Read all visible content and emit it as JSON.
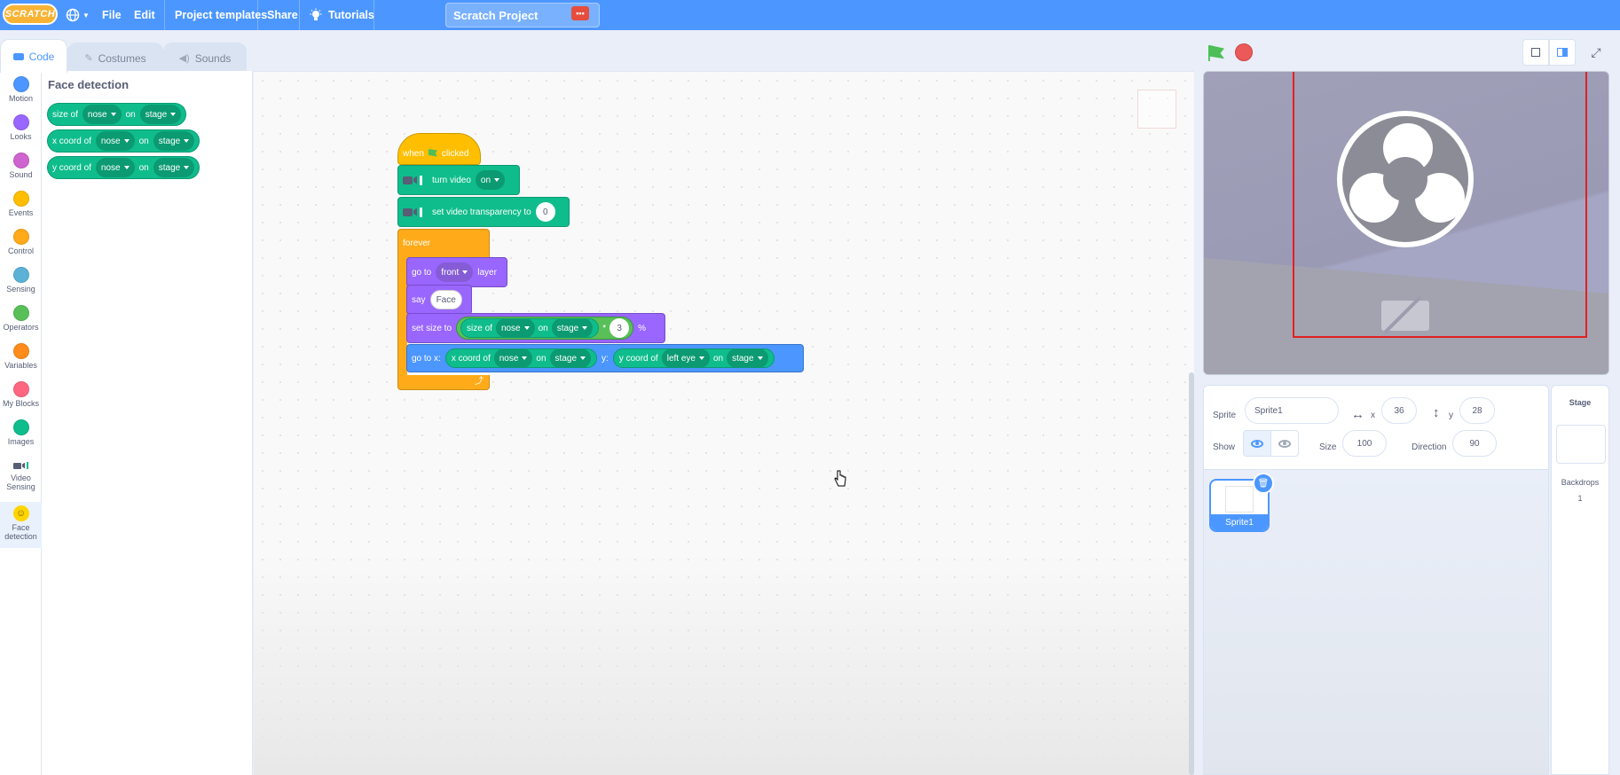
{
  "menubar": {
    "logo": "SCRATCH",
    "file": "File",
    "edit": "Edit",
    "project_templates": "Project templates",
    "share": "Share",
    "tutorials": "Tutorials",
    "project_title": "Scratch Project"
  },
  "tabs": {
    "code": "Code",
    "costumes": "Costumes",
    "sounds": "Sounds"
  },
  "categories": [
    {
      "label": "Motion",
      "color": "#4c97ff"
    },
    {
      "label": "Looks",
      "color": "#9966ff"
    },
    {
      "label": "Sound",
      "color": "#cf63cf"
    },
    {
      "label": "Events",
      "color": "#ffbf00"
    },
    {
      "label": "Control",
      "color": "#ffab19"
    },
    {
      "label": "Sensing",
      "color": "#5cb1d6"
    },
    {
      "label": "Operators",
      "color": "#59c059"
    },
    {
      "label": "Variables",
      "color": "#ff8c1a"
    },
    {
      "label": "My Blocks",
      "color": "#ff6680"
    },
    {
      "label": "Images",
      "color": "#0fbd8c"
    },
    {
      "label": "Video Sensing",
      "color": "#0fbd8c"
    },
    {
      "label": "Face detection",
      "color": "#ffd500"
    }
  ],
  "palette": {
    "title": "Face detection",
    "blocks": [
      {
        "prefix": "size of",
        "part": "nose",
        "on": "on",
        "target": "stage"
      },
      {
        "prefix": "x coord of",
        "part": "nose",
        "on": "on",
        "target": "stage"
      },
      {
        "prefix": "y coord of",
        "part": "nose",
        "on": "on",
        "target": "stage"
      }
    ]
  },
  "script": {
    "hat": {
      "when": "when",
      "clicked": "clicked"
    },
    "turn_video": {
      "label": "turn video",
      "value": "on"
    },
    "transparency": {
      "label": "set video transparency to",
      "value": "0"
    },
    "forever": "forever",
    "go_to_layer": {
      "label": "go to",
      "value": "front",
      "suffix": "layer"
    },
    "say": {
      "label": "say",
      "value": "Face"
    },
    "set_size": {
      "label": "set size to",
      "reporter": "size of",
      "part": "nose",
      "on": "on",
      "target": "stage",
      "op": "*",
      "num": "3",
      "suffix": "%"
    },
    "go_to_xy": {
      "label": "go to x:",
      "x_reporter": "x coord of",
      "x_part": "nose",
      "on": "on",
      "x_target": "stage",
      "y_label": "y:",
      "y_reporter": "y coord of",
      "y_part": "left eye",
      "y_target": "stage"
    }
  },
  "sprite_info": {
    "sprite_label": "Sprite",
    "sprite_name": "Sprite1",
    "x_label": "x",
    "x_value": "36",
    "y_label": "y",
    "y_value": "28",
    "show_label": "Show",
    "size_label": "Size",
    "size_value": "100",
    "direction_label": "Direction",
    "direction_value": "90"
  },
  "sprites": [
    {
      "name": "Sprite1"
    }
  ],
  "stage_pane": {
    "title": "Stage",
    "backdrops_label": "Backdrops",
    "backdrops_count": "1"
  }
}
